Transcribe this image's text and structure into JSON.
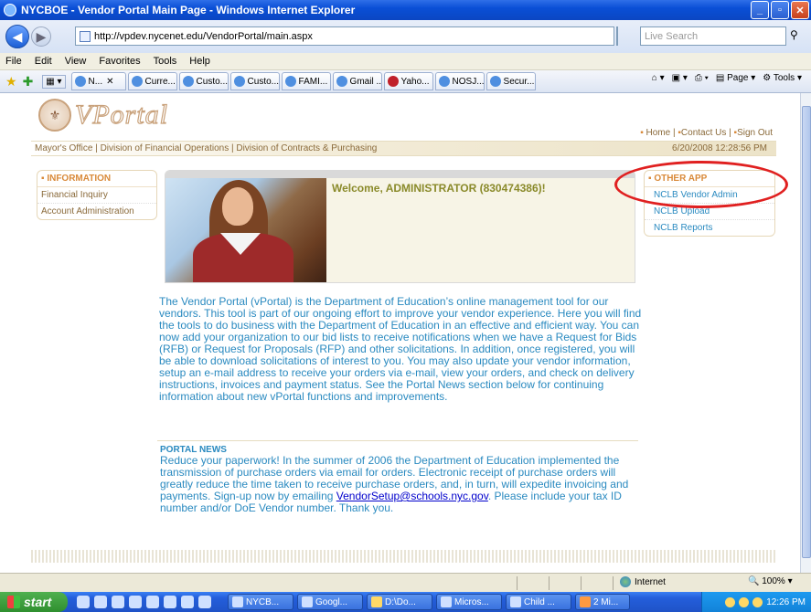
{
  "window": {
    "title": "NYCBOE - Vendor Portal Main Page - Windows Internet Explorer"
  },
  "address": {
    "url": "http://vpdev.nycenet.edu/VendorPortal/main.aspx",
    "search_placeholder": "Live Search"
  },
  "menu": [
    "File",
    "Edit",
    "View",
    "Favorites",
    "Tools",
    "Help"
  ],
  "tabs": [
    "N...",
    "Curre...",
    "Custo...",
    "Custo...",
    "FAMI...",
    "Gmail ...",
    "Yaho...",
    "NOSJ...",
    "Secur..."
  ],
  "commandbar": {
    "page": "Page",
    "tools": "Tools"
  },
  "site": {
    "logo_text": "VPortal",
    "top_links": [
      "Home",
      "Contact Us",
      "Sign Out"
    ],
    "org_links": [
      "Mayor's Office",
      "Division of Financial Operations",
      "Division of Contracts & Purchasing"
    ],
    "datetime": "6/20/2008 12:28:56 PM"
  },
  "left_panel": {
    "header": "INFORMATION",
    "items": [
      "Financial Inquiry",
      "Account Administration"
    ]
  },
  "right_panel": {
    "header": "OTHER APP",
    "items": [
      "NCLB Vendor Admin",
      "NCLB Upload",
      "NCLB Reports"
    ]
  },
  "welcome": "Welcome, ADMINISTRATOR (830474386)!",
  "intro": "The Vendor Portal (vPortal) is the Department of Education’s online management tool for our vendors. This tool is part of our ongoing effort to improve your vendor experience. Here you will find the tools to do business with the Department of Education in an effective and efficient way. You can now add your organization to our bid lists to receive notifications when we have a Request for Bids (RFB) or Request for Proposals (RFP) and other solicitations. In addition, once registered, you will be able to download solicitations of interest to you. You may also update your vendor information, setup an e-mail address to receive your orders via e-mail, view your orders, and check on delivery instructions, invoices and payment status. See the Portal News section below for continuing information about new vPortal functions and improvements.",
  "news": {
    "header": "PORTAL NEWS",
    "text_before": "Reduce your paperwork! In the summer of 2006 the Department of Education implemented the transmission of purchase orders via email for orders. Electronic receipt of purchase orders will greatly reduce the time taken to receive purchase orders, and, in turn, will expedite invoicing and payments. Sign-up now by emailing ",
    "email": "VendorSetup@schools.nyc.gov",
    "text_after": ". Please include your tax ID number and/or DoE Vendor number. Thank you."
  },
  "status": {
    "zone": "Internet",
    "zoom": "100%"
  },
  "taskbar": {
    "start": "start",
    "buttons": [
      "NYCB...",
      "Googl...",
      "D:\\Do...",
      "Micros...",
      "Child ...",
      "2 Mi..."
    ],
    "clock": "12:26 PM"
  },
  "colors": {
    "accent_orange": "#d98a3a",
    "link_blue": "#2a8ac0",
    "highlight_red": "#e02020"
  }
}
